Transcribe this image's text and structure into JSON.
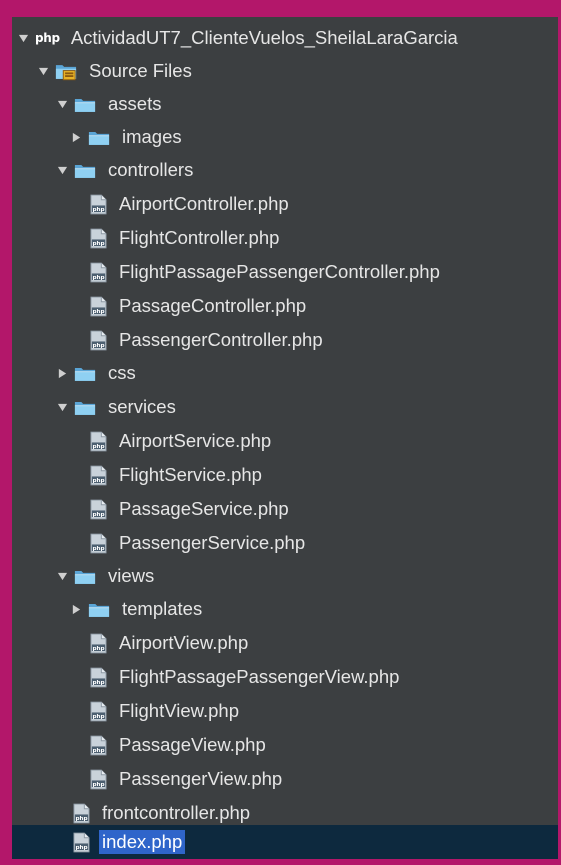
{
  "colors": {
    "frame": "#b3176a",
    "panel": "#3c3f41",
    "text": "#e6e6e6",
    "selected_row": "#0d293e",
    "selected_label": "#2f65ca",
    "folder": "#7ec6ee",
    "php_file": "#c9d2da"
  },
  "project": {
    "badge": "php",
    "name": "ActividadUT7_ClienteVuelos_SheilaLaraGarcia"
  },
  "source_files": {
    "label": "Source Files"
  },
  "tree": {
    "assets": "assets",
    "images": "images",
    "controllers": "controllers",
    "airport_controller": "AirportController.php",
    "flight_controller": "FlightController.php",
    "flight_passage_passenger_controller": "FlightPassagePassengerController.php",
    "passage_controller": "PassageController.php",
    "passenger_controller": "PassengerController.php",
    "css": "css",
    "services": "services",
    "airport_service": "AirportService.php",
    "flight_service": "FlightService.php",
    "passage_service": "PassageService.php",
    "passenger_service": "PassengerService.php",
    "views": "views",
    "templates": "templates",
    "airport_view": "AirportView.php",
    "flight_passage_passenger_view": "FlightPassagePassengerView.php",
    "flight_view": "FlightView.php",
    "passage_view": "PassageView.php",
    "passenger_view": "PassengerView.php",
    "frontcontroller": "frontcontroller.php",
    "index": "index.php"
  }
}
